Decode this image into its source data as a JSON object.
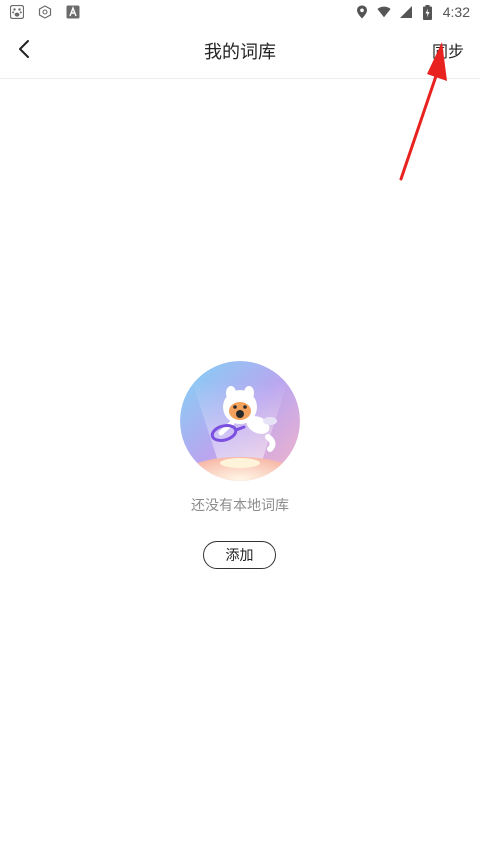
{
  "status_bar": {
    "left_icons": [
      "baidu-paw-icon",
      "hexagon-app-icon",
      "text-a-icon"
    ],
    "right_icons": [
      "location-icon",
      "wifi-icon",
      "cell-signal-icon",
      "battery-charging-icon"
    ],
    "time": "4:32"
  },
  "app_bar": {
    "back_icon": "chevron-left-icon",
    "title": "我的词库",
    "sync_label": "同步"
  },
  "annotation": {
    "arrow_color": "#e8231f",
    "points_to": "sync-button"
  },
  "empty_state": {
    "illustration": "mascot-with-magnifier",
    "message": "还没有本地词库",
    "add_label": "添加"
  }
}
